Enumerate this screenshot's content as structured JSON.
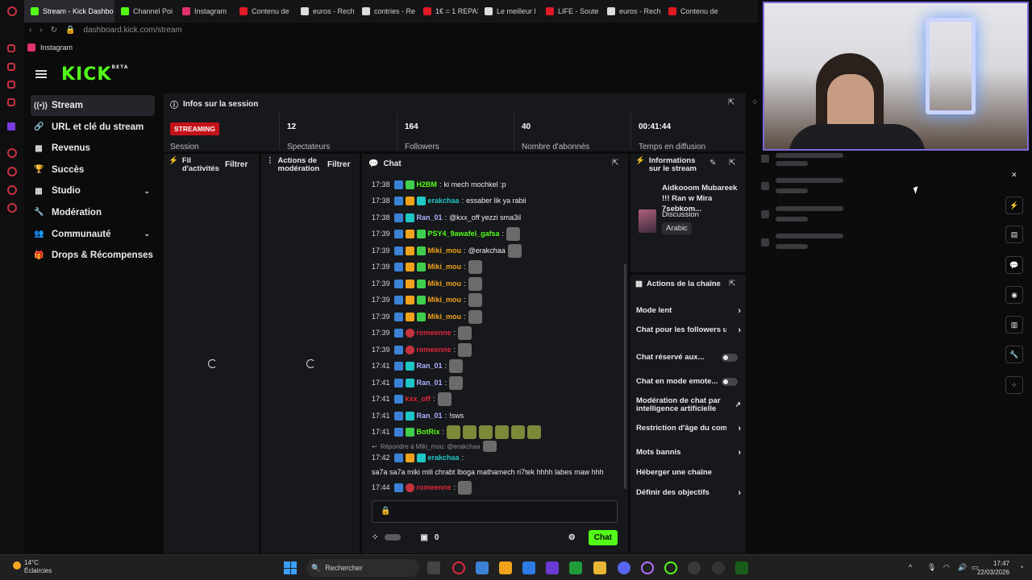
{
  "browser": {
    "tabs": [
      {
        "label": "Stream - Kick Dashbo",
        "color": "#53fc18",
        "active": true
      },
      {
        "label": "Channel Poi",
        "color": "#53fc18"
      },
      {
        "label": "Instagram",
        "color": "#e1306c"
      },
      {
        "label": "Contenu de",
        "color": "#e01b24"
      },
      {
        "label": "euros - Rech",
        "color": "#dddddd"
      },
      {
        "label": "contries - Re",
        "color": "#dddddd"
      },
      {
        "label": "1€ = 1 REPAS",
        "color": "#e01b24"
      },
      {
        "label": "Le meilleur l",
        "color": "#dddddd"
      },
      {
        "label": "LIFE - Soute",
        "color": "#e01b24"
      },
      {
        "label": "euros - Rech",
        "color": "#dddddd"
      },
      {
        "label": "Contenu de",
        "color": "#e01b24"
      }
    ],
    "url": "dashboard.kick.com/stream",
    "bookmark": "Instagram"
  },
  "kick": {
    "logo": "KICK",
    "logo_sup": "BETA"
  },
  "sidebar": {
    "items": [
      {
        "label": "Stream",
        "icon": "broadcast-icon",
        "glyph": "((•))",
        "active": true
      },
      {
        "label": "URL et clé du stream",
        "icon": "link-icon",
        "glyph": "🔗"
      },
      {
        "label": "Revenus",
        "icon": "chart-icon",
        "glyph": "▦"
      },
      {
        "label": "Succès",
        "icon": "trophy-icon",
        "glyph": "🏆"
      },
      {
        "label": "Studio",
        "icon": "grid-icon",
        "glyph": "▦",
        "chevron": true
      },
      {
        "label": "Modération",
        "icon": "wrench-icon",
        "glyph": "🔧"
      },
      {
        "label": "Communauté",
        "icon": "people-icon",
        "glyph": "👥",
        "chevron": true
      },
      {
        "label": "Drops & Récompenses",
        "icon": "gift-icon",
        "glyph": "🎁"
      }
    ]
  },
  "session": {
    "title": "Infos sur la session",
    "badge": "STREAMING",
    "session_label": "Session",
    "stats": [
      {
        "value": "12",
        "label": "Spectateurs"
      },
      {
        "value": "164",
        "label": "Followers"
      },
      {
        "value": "40",
        "label": "Nombre d'abonnés"
      },
      {
        "value": "00:41:44",
        "label": "Temps en diffusion"
      }
    ]
  },
  "activity": {
    "title_1": "Fil",
    "title_2": "d'activités",
    "filter": "Filtrer"
  },
  "moderation": {
    "title_1": "Actions de",
    "title_2": "modération",
    "filter": "Filtrer"
  },
  "chat": {
    "title": "Chat",
    "messages": [
      {
        "time": "17:38",
        "badges": [
          "a",
          "g"
        ],
        "user": "H2BM",
        "color": "#53fc18",
        "text": "ki mech mochkel :p"
      },
      {
        "time": "17:38",
        "badges": [
          "a",
          "o",
          "s"
        ],
        "user": "erakchaa",
        "color": "#1fc6c6",
        "text": "essaber lik ya rabii"
      },
      {
        "time": "17:38",
        "badges": [
          "a",
          "s"
        ],
        "user": "Ran_01",
        "color": "#aab0ff",
        "text": "@kxx_off yezzi sma3il"
      },
      {
        "time": "17:39",
        "badges": [
          "a",
          "o",
          "g"
        ],
        "user": "PSY4_9awafel_gafsa",
        "color": "#53fc18",
        "text": "",
        "emote": true
      },
      {
        "time": "17:39",
        "badges": [
          "a",
          "o",
          "g"
        ],
        "user": "Miki_mou",
        "color": "#f0a31a",
        "text": "@erakchaa",
        "emote": true
      },
      {
        "time": "17:39",
        "badges": [
          "a",
          "o",
          "g"
        ],
        "user": "Miki_mou",
        "color": "#f0a31a",
        "text": "",
        "emote": true
      },
      {
        "time": "17:39",
        "badges": [
          "a",
          "o",
          "g"
        ],
        "user": "Miki_mou",
        "color": "#f0a31a",
        "text": "",
        "emote": true
      },
      {
        "time": "17:39",
        "badges": [
          "a",
          "o",
          "g"
        ],
        "user": "Miki_mou",
        "color": "#f0a31a",
        "text": "",
        "emote": true
      },
      {
        "time": "17:39",
        "badges": [
          "a",
          "o",
          "g"
        ],
        "user": "Miki_mou",
        "color": "#f0a31a",
        "text": "",
        "emote": true
      },
      {
        "time": "17:39",
        "badges": [
          "a",
          "r"
        ],
        "user": "romeenne",
        "color": "#e0263a",
        "text": "",
        "emote": true
      },
      {
        "time": "17:39",
        "badges": [
          "a",
          "r"
        ],
        "user": "romeenne",
        "color": "#e0263a",
        "text": "",
        "emote": true
      },
      {
        "time": "17:41",
        "badges": [
          "a",
          "s"
        ],
        "user": "Ran_01",
        "color": "#aab0ff",
        "text": "",
        "emote": true
      },
      {
        "time": "17:41",
        "badges": [
          "a",
          "s"
        ],
        "user": "Ran_01",
        "color": "#aab0ff",
        "text": "",
        "emote": true
      },
      {
        "time": "17:41",
        "badges": [
          "a"
        ],
        "user": "kxx_off",
        "color": "#e0263a",
        "text": "",
        "emote": true
      },
      {
        "time": "17:41",
        "badges": [
          "a",
          "s"
        ],
        "user": "Ran_01",
        "color": "#aab0ff",
        "text": "!sws"
      },
      {
        "time": "17:41",
        "badges": [
          "a",
          "g"
        ],
        "user": "BotRix",
        "color": "#53fc18",
        "text": "",
        "emote_row": true
      }
    ],
    "reply": "Répondre à Miki_mou: @erakchaa",
    "reply_message": {
      "time": "17:42",
      "user": "erakchaa",
      "color": "#1fc6c6",
      "text": "sa7a sa7a miki mili chrabt lboga mathamech ri7tek hhhh labes maw hhh"
    },
    "last_message": {
      "time": "17:44",
      "user": "romeenne",
      "color": "#e0263a"
    },
    "sub_count": "0",
    "send_label": "Chat"
  },
  "stream_info": {
    "title_1": "Informations",
    "title_2": "sur le stream",
    "stream_title": "Aidkooom Mubareek !!! Ran w Mira 7sebkom...",
    "category": "Discussion",
    "language": "Arabic"
  },
  "channel_actions": {
    "title": "Actions de la chaîne",
    "items": [
      {
        "label": "Mode lent",
        "type": "arrow"
      },
      {
        "label": "Chat pour les followers u",
        "type": "arrow"
      },
      {
        "label": "Chat réservé aux...",
        "type": "toggle"
      },
      {
        "label": "Chat en mode emote...",
        "type": "toggle"
      },
      {
        "label": "Modération de chat par intelligence artificielle",
        "type": "ext"
      },
      {
        "label": "Restriction d'âge du com",
        "type": "arrow"
      },
      {
        "label": "Mots bannis",
        "type": "arrow"
      },
      {
        "label": "Héberger une chaîne",
        "type": "none"
      },
      {
        "label": "Définir des objectifs",
        "type": "arrow"
      }
    ]
  },
  "taskbar": {
    "temperature": "14°C",
    "weather": "Éclaircies",
    "search": "Rechercher",
    "time": "17:47",
    "date": "22/03/2026"
  }
}
